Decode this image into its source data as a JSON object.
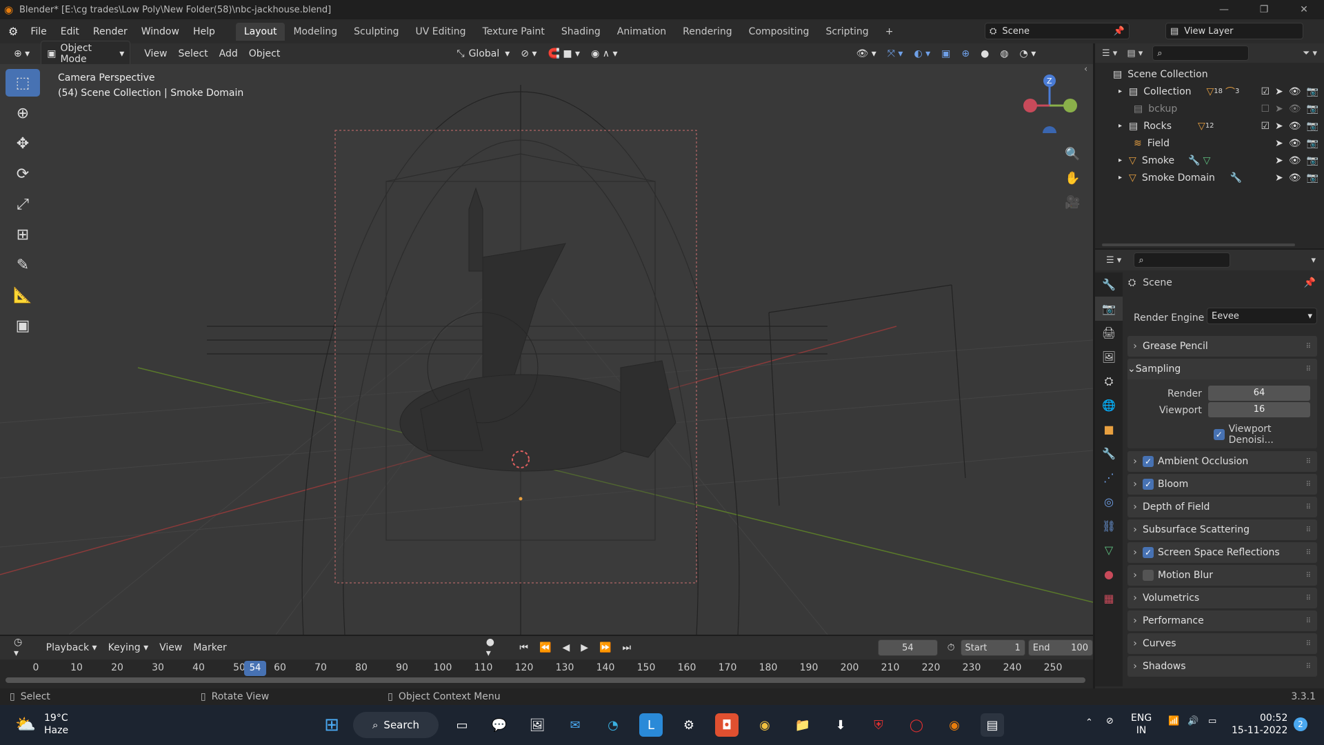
{
  "titlebar": {
    "title": "Blender* [E:\\cg trades\\Low Poly\\New Folder(58)\\nbc-jackhouse.blend]",
    "minimize": "—",
    "maximize": "❐",
    "close": "✕"
  },
  "menu": [
    "File",
    "Edit",
    "Render",
    "Window",
    "Help"
  ],
  "workspaces": [
    "Layout",
    "Modeling",
    "Sculpting",
    "UV Editing",
    "Texture Paint",
    "Shading",
    "Animation",
    "Rendering",
    "Compositing",
    "Scripting",
    "+"
  ],
  "scene": "Scene",
  "view_layer": "View Layer",
  "viewport_header": {
    "mode": "Object Mode",
    "menus": [
      "View",
      "Select",
      "Add",
      "Object"
    ],
    "transform": "Global"
  },
  "viewport": {
    "overlay_line1": "Camera Perspective",
    "overlay_line2": "(54) Scene Collection | Smoke Domain",
    "gizmo_z": "Z"
  },
  "outliner": {
    "root": "Scene Collection",
    "items": [
      {
        "name": "Collection",
        "badge": "18",
        "badge2": "3",
        "checked": true
      },
      {
        "name": "bckup",
        "checked": false
      },
      {
        "name": "Rocks",
        "badge": "12",
        "checked": true
      },
      {
        "name": "Field"
      },
      {
        "name": "Smoke"
      },
      {
        "name": "Smoke Domain"
      }
    ]
  },
  "properties": {
    "context": "Scene",
    "render_engine_label": "Render Engine",
    "render_engine": "Eevee",
    "sampling": {
      "title": "Sampling",
      "render_label": "Render",
      "render_value": "64",
      "viewport_label": "Viewport",
      "viewport_value": "16",
      "denoise": "Viewport Denoisi..."
    },
    "panels": [
      {
        "label": "Grease Pencil",
        "checkbox": null
      },
      {
        "label": "Ambient Occlusion",
        "checkbox": true
      },
      {
        "label": "Bloom",
        "checkbox": true
      },
      {
        "label": "Depth of Field",
        "checkbox": null
      },
      {
        "label": "Subsurface Scattering",
        "checkbox": null
      },
      {
        "label": "Screen Space Reflections",
        "checkbox": true
      },
      {
        "label": "Motion Blur",
        "checkbox": false
      },
      {
        "label": "Volumetrics",
        "checkbox": null
      },
      {
        "label": "Performance",
        "checkbox": null
      },
      {
        "label": "Curves",
        "checkbox": null
      },
      {
        "label": "Shadows",
        "checkbox": null
      }
    ]
  },
  "timeline": {
    "menus": [
      "Playback",
      "Keying",
      "View",
      "Marker"
    ],
    "current_frame": "54",
    "start_label": "Start",
    "start": "1",
    "end_label": "End",
    "end": "100",
    "ticks": [
      "0",
      "10",
      "20",
      "30",
      "40",
      "50",
      "60",
      "70",
      "80",
      "90",
      "100",
      "110",
      "120",
      "130",
      "140",
      "150",
      "160",
      "170",
      "180",
      "190",
      "200",
      "210",
      "220",
      "230",
      "240",
      "250"
    ],
    "playhead": "54"
  },
  "statusbar": {
    "select": "Select",
    "rotate": "Rotate View",
    "context": "Object Context Menu",
    "version": "3.3.1"
  },
  "taskbar": {
    "temp": "19°C",
    "weather": "Haze",
    "search": "Search",
    "lang1": "ENG",
    "lang2": "IN",
    "time": "00:52",
    "date": "15-11-2022",
    "notif": "2"
  }
}
